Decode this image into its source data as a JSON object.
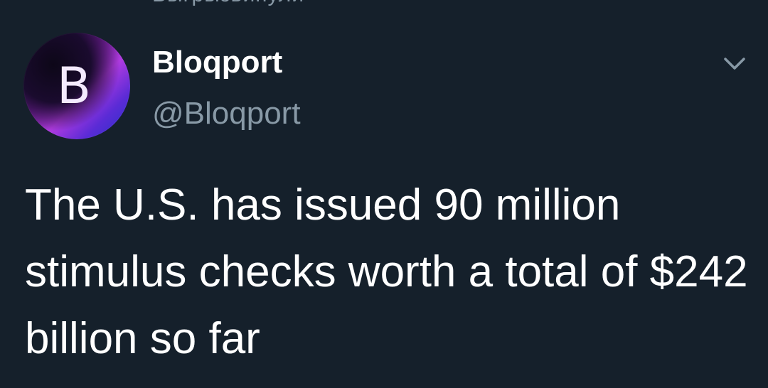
{
  "context_line": "Выгрызвипули",
  "tweet": {
    "author": {
      "avatar_letter": "B",
      "display_name": "Bloqport",
      "handle": "@Bloqport"
    },
    "menu_icon": "chevron-down-icon",
    "text": "The U.S. has issued 90 million stimulus checks worth a total of $242 billion so far"
  },
  "colors": {
    "background": "#15202b",
    "text_primary": "#ffffff",
    "text_secondary": "#8899a6",
    "avatar_gradient": [
      "#2a0c3f",
      "#7b1fa2",
      "#b03be0",
      "#2430c8"
    ]
  }
}
